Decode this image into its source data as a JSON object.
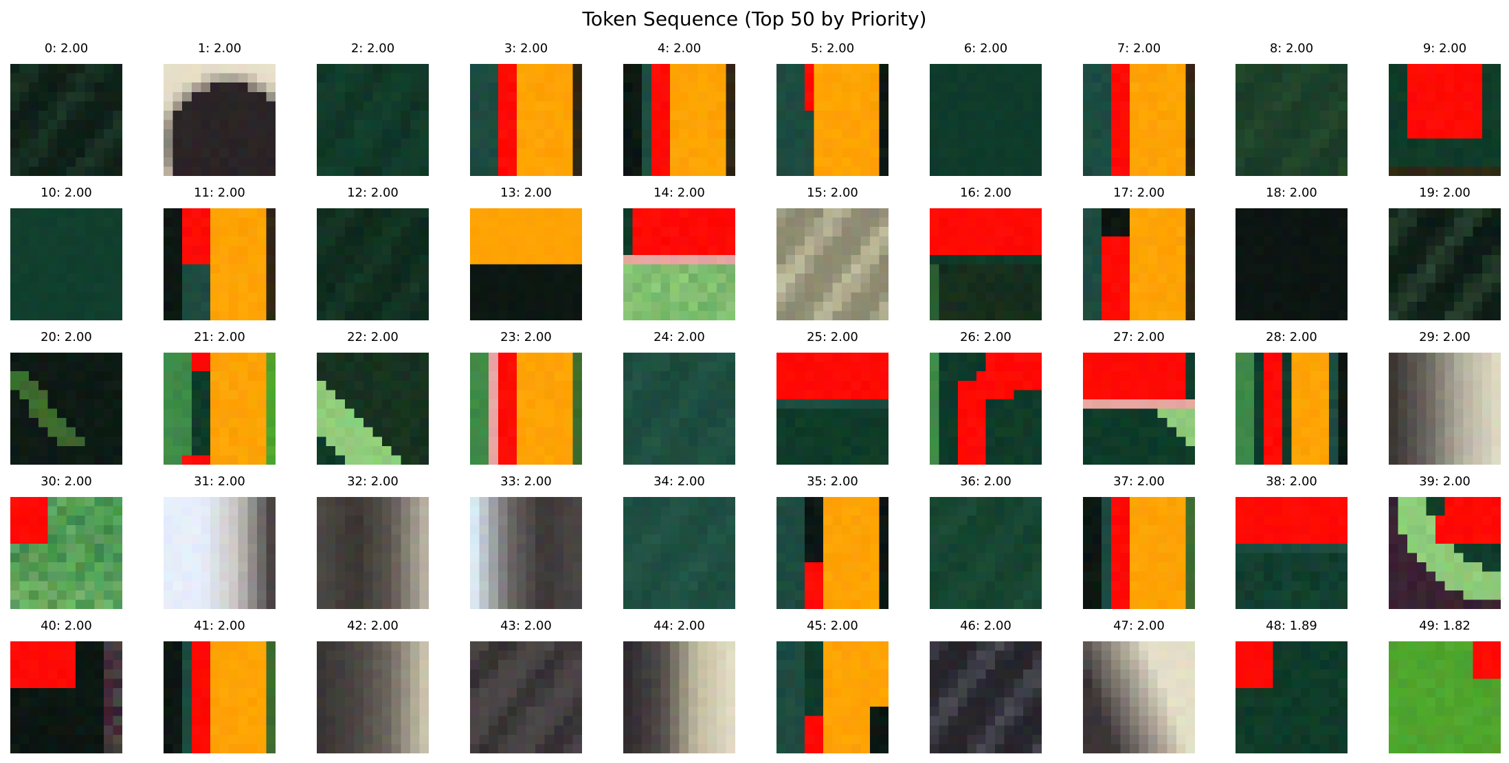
{
  "chart_data": {
    "type": "image-grid",
    "title": "Token Sequence (Top 50 by Priority)",
    "rows": 5,
    "cols": 10,
    "palette": {
      "dg": "#0f3b29",
      "dk": "#0c1712",
      "rd": "#ff0a05",
      "or": "#ffa305",
      "lg": "#8fcb7a",
      "gr": "#4a4a48",
      "dgr": "#2b292c",
      "cr": "#d6d3b8",
      "wh": "#e8f0fb",
      "tl": "#1d4b40",
      "br": "#2f2614",
      "pk": "#e8a6a0",
      "mg": "#3f8a48",
      "lgg": "#4ea52e",
      "ol": "#3d6a2d",
      "pr": "#3a2233"
    },
    "tiles": [
      {
        "index": 0,
        "priority": "2.00",
        "label": "0: 2.00",
        "kind": "noise",
        "base": "#0f1f17",
        "accent": "#1d3a2a"
      },
      {
        "index": 1,
        "priority": "2.00",
        "label": "1: 2.00",
        "kind": "dome",
        "base": "#2a2426",
        "accent": "#e6dec8"
      },
      {
        "index": 2,
        "priority": "2.00",
        "label": "2: 2.00",
        "kind": "noise",
        "base": "#123d2c",
        "accent": "#0f2f22"
      },
      {
        "index": 3,
        "priority": "2.00",
        "label": "3: 2.00",
        "kind": "vstripes",
        "stripes": [
          "tl",
          "tl",
          "rd",
          "rd",
          "or",
          "or",
          "or",
          "or",
          "or",
          "br"
        ]
      },
      {
        "index": 4,
        "priority": "2.00",
        "label": "4: 2.00",
        "kind": "vstripes",
        "stripes": [
          "dk",
          "tl",
          "rd",
          "rd",
          "or",
          "or",
          "or",
          "or",
          "or",
          "br"
        ]
      },
      {
        "index": 5,
        "priority": "2.00",
        "label": "5: 2.00",
        "kind": "vstripes5",
        "stripes": [
          "tl",
          "tl",
          "rd",
          "or",
          "or",
          "or",
          "or",
          "or",
          "dk"
        ]
      },
      {
        "index": 6,
        "priority": "2.00",
        "label": "6: 2.00",
        "kind": "flat",
        "base": "#0f3b2b"
      },
      {
        "index": 7,
        "priority": "2.00",
        "label": "7: 2.00",
        "kind": "vstripes",
        "stripes": [
          "tl",
          "tl",
          "rd",
          "rd",
          "or",
          "or",
          "or",
          "or",
          "or",
          "br"
        ]
      },
      {
        "index": 8,
        "priority": "2.00",
        "label": "8: 2.00",
        "kind": "noise",
        "base": "#1a3d28",
        "accent": "#274a2e"
      },
      {
        "index": 9,
        "priority": "2.00",
        "label": "9: 2.00",
        "kind": "block9"
      },
      {
        "index": 10,
        "priority": "2.00",
        "label": "10: 2.00",
        "kind": "flat",
        "base": "#113f2e"
      },
      {
        "index": 11,
        "priority": "2.00",
        "label": "11: 2.00",
        "kind": "vstripes11"
      },
      {
        "index": 12,
        "priority": "2.00",
        "label": "12: 2.00",
        "kind": "noise",
        "base": "#0f2a1d",
        "accent": "#163a28"
      },
      {
        "index": 13,
        "priority": "2.00",
        "label": "13: 2.00",
        "kind": "hsplit",
        "top": "#ffa305",
        "bottom": "#0c1712",
        "split": 0.5
      },
      {
        "index": 14,
        "priority": "2.00",
        "label": "14: 2.00",
        "kind": "t14"
      },
      {
        "index": 15,
        "priority": "2.00",
        "label": "15: 2.00",
        "kind": "noise",
        "base": "#8d8a72",
        "accent": "#c9c6a5"
      },
      {
        "index": 16,
        "priority": "2.00",
        "label": "16: 2.00",
        "kind": "t16"
      },
      {
        "index": 17,
        "priority": "2.00",
        "label": "17: 2.00",
        "kind": "vstripes17"
      },
      {
        "index": 18,
        "priority": "2.00",
        "label": "18: 2.00",
        "kind": "flat",
        "base": "#0c1512"
      },
      {
        "index": 19,
        "priority": "2.00",
        "label": "19: 2.00",
        "kind": "noise",
        "base": "#0d1d15",
        "accent": "#2e4a35"
      },
      {
        "index": 20,
        "priority": "2.00",
        "label": "20: 2.00",
        "kind": "diag20"
      },
      {
        "index": 21,
        "priority": "2.00",
        "label": "21: 2.00",
        "kind": "vstripes21"
      },
      {
        "index": 22,
        "priority": "2.00",
        "label": "22: 2.00",
        "kind": "diag22"
      },
      {
        "index": 23,
        "priority": "2.00",
        "label": "23: 2.00",
        "kind": "vstripes",
        "stripes": [
          "mg",
          "pk",
          "rd",
          "rd",
          "or",
          "or",
          "or",
          "or",
          "or",
          "ol"
        ]
      },
      {
        "index": 24,
        "priority": "2.00",
        "label": "24: 2.00",
        "kind": "noise",
        "base": "#1c4a3d",
        "accent": "#235646"
      },
      {
        "index": 25,
        "priority": "2.00",
        "label": "25: 2.00",
        "kind": "t25"
      },
      {
        "index": 26,
        "priority": "2.00",
        "label": "26: 2.00",
        "kind": "t26"
      },
      {
        "index": 27,
        "priority": "2.00",
        "label": "27: 2.00",
        "kind": "t27"
      },
      {
        "index": 28,
        "priority": "2.00",
        "label": "28: 2.00",
        "kind": "vstripes",
        "stripes": [
          "mg",
          "dg",
          "rd",
          "rd",
          "dg",
          "or",
          "or",
          "or",
          "tl",
          "dk"
        ]
      },
      {
        "index": 29,
        "priority": "2.00",
        "label": "29: 2.00",
        "kind": "hgrad",
        "colors": [
          "#3a3834",
          "#6b6760",
          "#b5b09e",
          "#dcd8c2"
        ]
      },
      {
        "index": 30,
        "priority": "2.00",
        "label": "30: 2.00",
        "kind": "t30"
      },
      {
        "index": 31,
        "priority": "2.00",
        "label": "31: 2.00",
        "kind": "hgrad",
        "colors": [
          "#e6eefb",
          "#e6eefb",
          "#c9c6c2",
          "#4a4645"
        ]
      },
      {
        "index": 32,
        "priority": "2.00",
        "label": "32: 2.00",
        "kind": "hgrad",
        "colors": [
          "#4b4744",
          "#3a3533",
          "#5a544e",
          "#b5b0a0"
        ]
      },
      {
        "index": 33,
        "priority": "2.00",
        "label": "33: 2.00",
        "kind": "hgrad",
        "colors": [
          "#d9e9f2",
          "#6b6766",
          "#3b3737",
          "#4a4644"
        ]
      },
      {
        "index": 34,
        "priority": "2.00",
        "label": "34: 2.00",
        "kind": "noise",
        "base": "#1d4c40",
        "accent": "#245748"
      },
      {
        "index": 35,
        "priority": "2.00",
        "label": "35: 2.00",
        "kind": "vstripes35"
      },
      {
        "index": 36,
        "priority": "2.00",
        "label": "36: 2.00",
        "kind": "noise",
        "base": "#15432f",
        "accent": "#1c4d39"
      },
      {
        "index": 37,
        "priority": "2.00",
        "label": "37: 2.00",
        "kind": "vstripes",
        "stripes": [
          "dk",
          "tl",
          "rd",
          "rd",
          "or",
          "or",
          "or",
          "or",
          "or",
          "ol"
        ]
      },
      {
        "index": 38,
        "priority": "2.00",
        "label": "38: 2.00",
        "kind": "t38"
      },
      {
        "index": 39,
        "priority": "2.00",
        "label": "39: 2.00",
        "kind": "t39"
      },
      {
        "index": 40,
        "priority": "2.00",
        "label": "40: 2.00",
        "kind": "t40"
      },
      {
        "index": 41,
        "priority": "2.00",
        "label": "41: 2.00",
        "kind": "vstripes",
        "stripes": [
          "dk",
          "tl",
          "rd",
          "rd",
          "or",
          "or",
          "or",
          "or",
          "or",
          "ol"
        ]
      },
      {
        "index": 42,
        "priority": "2.00",
        "label": "42: 2.00",
        "kind": "hgrad",
        "colors": [
          "#3a3635",
          "#4a4542",
          "#6e685f",
          "#c9c3ac"
        ]
      },
      {
        "index": 43,
        "priority": "2.00",
        "label": "43: 2.00",
        "kind": "noise",
        "base": "#4b4647",
        "accent": "#2d292b"
      },
      {
        "index": 44,
        "priority": "2.00",
        "label": "44: 2.00",
        "kind": "hgrad",
        "colors": [
          "#2e2b2e",
          "#4f4a48",
          "#c2bb9f",
          "#e0dbc3"
        ]
      },
      {
        "index": 45,
        "priority": "2.00",
        "label": "45: 2.00",
        "kind": "vstripes45"
      },
      {
        "index": 46,
        "priority": "2.00",
        "label": "46: 2.00",
        "kind": "noise",
        "base": "#26252b",
        "accent": "#505059"
      },
      {
        "index": 47,
        "priority": "2.00",
        "label": "47: 2.00",
        "kind": "t47"
      },
      {
        "index": 48,
        "priority": "1.89",
        "label": "48: 1.89",
        "kind": "t48"
      },
      {
        "index": 49,
        "priority": "1.82",
        "label": "49: 1.82",
        "kind": "t49"
      }
    ]
  }
}
